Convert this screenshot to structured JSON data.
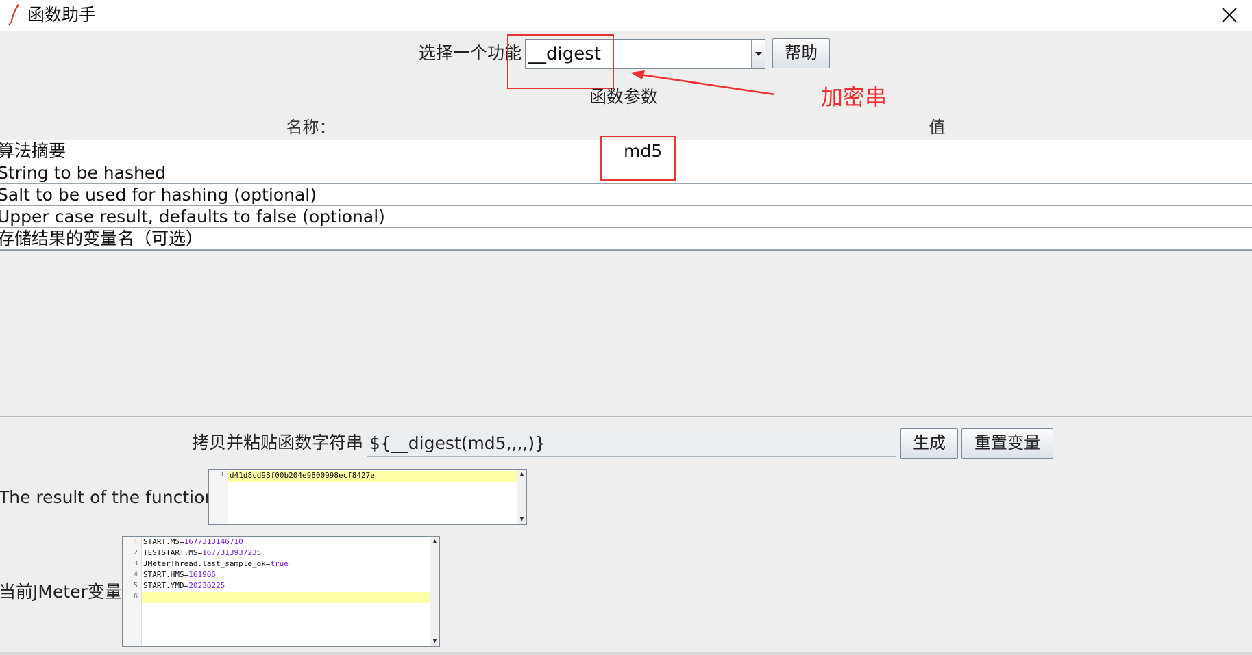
{
  "window": {
    "title": "函数助手"
  },
  "function_select": {
    "label": "选择一个功能",
    "value": "__digest",
    "help_button": "帮助"
  },
  "params": {
    "section_label": "函数参数",
    "columns": [
      "名称：",
      "值"
    ],
    "rows": [
      {
        "name": "算法摘要",
        "value": "md5"
      },
      {
        "name": "String to be hashed",
        "value": ""
      },
      {
        "name": "Salt to be used for hashing (optional)",
        "value": ""
      },
      {
        "name": "Upper case result, defaults to false (optional)",
        "value": ""
      },
      {
        "name": "存储结果的变量名（可选）",
        "value": ""
      }
    ]
  },
  "function_string": {
    "label": "拷贝并粘贴函数字符串",
    "value": "${__digest(md5,,,,)}",
    "generate_button": "生成",
    "reset_button": "重置变量"
  },
  "result": {
    "label": "The result of the function is",
    "lines": [
      "d41d8cd98f00b204e9800998ecf8427e"
    ],
    "line_numbers": [
      "1"
    ]
  },
  "variables": {
    "label": "当前JMeter变量",
    "line_numbers": [
      "1",
      "2",
      "3",
      "4",
      "5",
      "6"
    ],
    "lines": [
      {
        "key": "START.MS=",
        "val": "1677313146710"
      },
      {
        "key": "TESTSTART.MS=",
        "val": "1677313937235"
      },
      {
        "key": "JMeterThread.last_sample_ok=",
        "val": "true"
      },
      {
        "key": "START.HMS=",
        "val": "161906"
      },
      {
        "key": "START.YMD=",
        "val": "20230225"
      },
      {
        "key": "",
        "val": ""
      }
    ]
  },
  "annotation": {
    "text": "加密串",
    "color": "#ee3030"
  },
  "colors": {
    "background": "#eeeeee",
    "annotation_red": "#e53535",
    "number_purple": "#7a1fd6",
    "highlight": "#ffffa8"
  }
}
